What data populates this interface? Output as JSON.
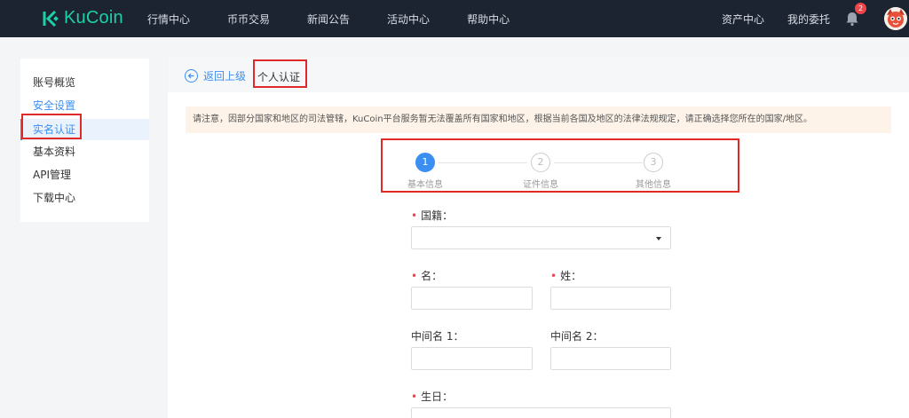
{
  "brand": {
    "name": "KuCoin",
    "color": "#1bd1a8"
  },
  "nav": {
    "left_items": [
      "行情中心",
      "币币交易",
      "新闻公告",
      "活动中心",
      "帮助中心"
    ],
    "right_items": [
      "资产中心",
      "我的委托"
    ],
    "notification_count": "2"
  },
  "sidebar": {
    "items": [
      {
        "label": "账号概览"
      },
      {
        "label": "安全设置"
      },
      {
        "label": "实名认证"
      },
      {
        "label": "基本资料"
      },
      {
        "label": "API管理"
      },
      {
        "label": "下载中心"
      }
    ],
    "active_index": 2
  },
  "header": {
    "back_label": "返回上级",
    "title": "个人认证"
  },
  "notice": "请注意，因部分国家和地区的司法管辖，KuCoin平台服务暂无法覆盖所有国家和地区，根据当前各国及地区的法律法规规定，请正确选择您所在的国家/地区。",
  "steps": [
    {
      "number": "1",
      "label": "基本信息",
      "state": "active"
    },
    {
      "number": "2",
      "label": "证件信息",
      "state": "pending"
    },
    {
      "number": "3",
      "label": "其他信息",
      "state": "pending"
    }
  ],
  "form": {
    "nationality_label": "国籍：",
    "first_name_label": "名：",
    "last_name_label": "姓：",
    "middle_name1_label": "中间名 1：",
    "middle_name2_label": "中间名 2：",
    "birthday_label": "生日："
  },
  "colors": {
    "accent": "#3b8ff0",
    "highlight_box": "#e02a2a",
    "required": "#f0454b"
  }
}
